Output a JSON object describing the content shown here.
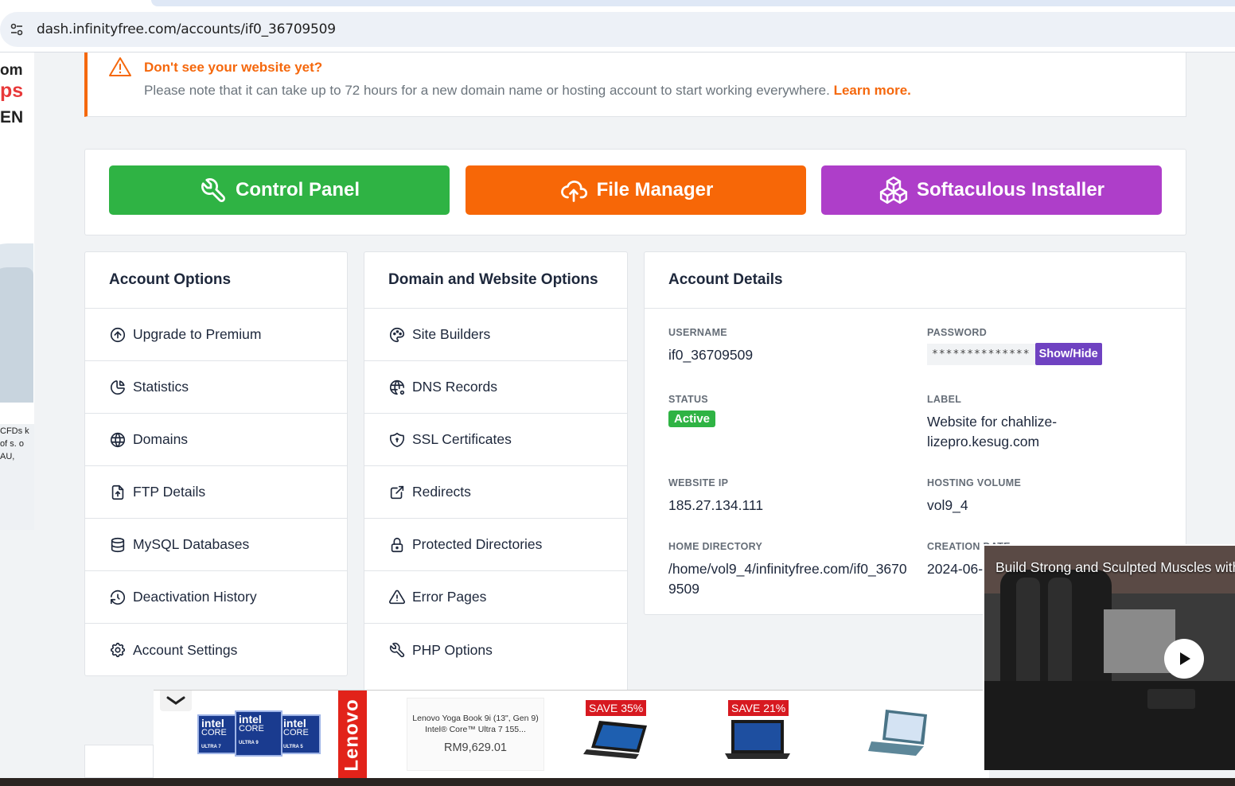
{
  "browser": {
    "url": "dash.infinityfree.com/accounts/if0_36709509"
  },
  "left_ad": {
    "line1": "om",
    "line2": "ps",
    "line3": "EN",
    "fineprint": "CFDs k of s. o AU,"
  },
  "alert": {
    "title": "Don't see your website yet?",
    "message": "Please note that it can take up to 72 hours for a new domain name or hosting account to start working everywhere.",
    "link": "Learn more."
  },
  "buttons": {
    "control_panel": "Control Panel",
    "file_manager": "File Manager",
    "softaculous": "Softaculous Installer"
  },
  "colors": {
    "green": "#2fb344",
    "orange": "#f76707",
    "purple": "#ae3ec9",
    "alert_orange": "#f5680d",
    "showhide": "#6f42c1"
  },
  "account_options": {
    "title": "Account Options",
    "items": [
      {
        "label": "Upgrade to Premium",
        "icon": "arrow-up-circle-icon"
      },
      {
        "label": "Statistics",
        "icon": "chart-pie-icon"
      },
      {
        "label": "Domains",
        "icon": "world-icon"
      },
      {
        "label": "FTP Details",
        "icon": "file-upload-icon"
      },
      {
        "label": "MySQL Databases",
        "icon": "database-icon"
      },
      {
        "label": "Deactivation History",
        "icon": "history-icon"
      },
      {
        "label": "Account Settings",
        "icon": "settings-icon"
      }
    ]
  },
  "domain_options": {
    "title": "Domain and Website Options",
    "items": [
      {
        "label": "Site Builders",
        "icon": "palette-icon"
      },
      {
        "label": "DNS Records",
        "icon": "world-cog-icon"
      },
      {
        "label": "SSL Certificates",
        "icon": "shield-lock-icon"
      },
      {
        "label": "Redirects",
        "icon": "external-link-icon"
      },
      {
        "label": "Protected Directories",
        "icon": "lock-icon"
      },
      {
        "label": "Error Pages",
        "icon": "alert-triangle-icon"
      },
      {
        "label": "PHP Options",
        "icon": "tool-icon"
      }
    ]
  },
  "account_details": {
    "title": "Account Details",
    "username_label": "USERNAME",
    "username": "if0_36709509",
    "password_label": "PASSWORD",
    "password_mask": "**************",
    "show_hide": "Show/Hide",
    "status_label": "STATUS",
    "status": "Active",
    "label_label": "LABEL",
    "label_value": "Website for chahlize-lizepro.kesug.com",
    "ip_label": "WEBSITE IP",
    "ip": "185.27.134.111",
    "volume_label": "HOSTING VOLUME",
    "volume": "vol9_4",
    "home_label": "HOME DIRECTORY",
    "home": "/home/vol9_4/infinityfree.com/if0_36709509",
    "created_label": "CREATION DATE",
    "created": "2024-06-"
  },
  "bottom_ad": {
    "intel": [
      {
        "brand": "intel",
        "core": "CORE",
        "tier": "ULTRA 7"
      },
      {
        "brand": "intel",
        "core": "CORE",
        "tier": "ULTRA 9"
      },
      {
        "brand": "intel",
        "core": "CORE",
        "tier": "ULTRA 5"
      }
    ],
    "lenovo": "Lenovo",
    "product_name": "Lenovo Yoga Book 9i (13\", Gen 9) Intel® Core™ Ultra 7 155...",
    "product_price": "RM9,629.01",
    "save1": "SAVE 35%",
    "save2": "SAVE 21%"
  },
  "video": {
    "title": "Build Strong and Sculpted Muscles with"
  }
}
